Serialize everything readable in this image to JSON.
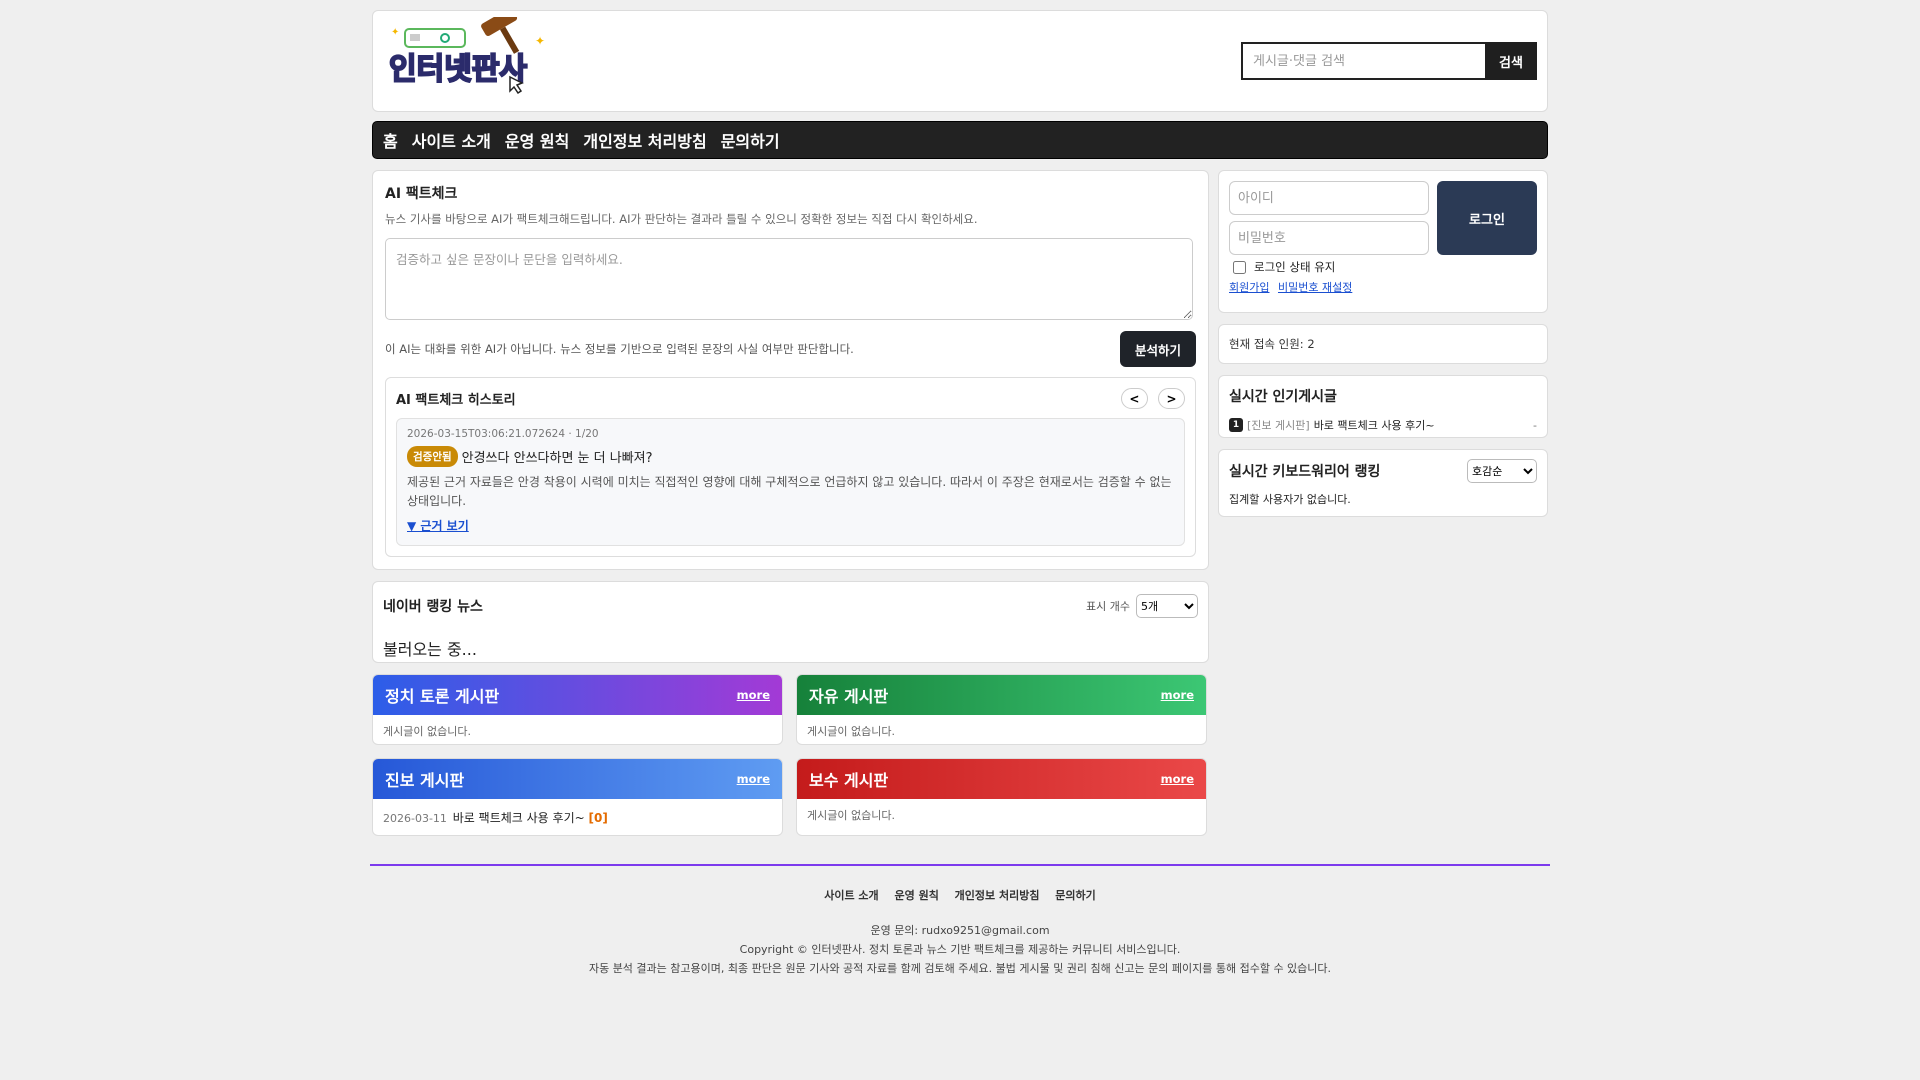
{
  "header": {
    "logo_text": "인터넷판사",
    "search_placeholder": "게시글·댓글 검색",
    "search_button": "검색"
  },
  "nav": [
    "홈",
    "사이트 소개",
    "운영 원칙",
    "개인정보 처리방침",
    "문의하기"
  ],
  "factcheck": {
    "title": "AI 팩트체크",
    "description": "뉴스 기사를 바탕으로 AI가 팩트체크해드립니다. AI가 판단하는 결과라 틀릴 수 있으니 정확한 정보는 직접 다시 확인하세요.",
    "textarea_placeholder": "검증하고 싶은 문장이나 문단을 입력하세요.",
    "note": "이 AI는 대화를 위한 AI가 아닙니다. 뉴스 정보를 기반으로 입력된 문장의 사실 여부만 판단합니다.",
    "analyze_button": "분석하기",
    "history": {
      "title": "AI 팩트체크 히스토리",
      "prev": "<",
      "next": ">",
      "entry": {
        "meta": "2026-03-15T03:06:21.072624 · 1/20",
        "badge": "검증안됨",
        "claim": "안경쓰다 안쓰다하면 눈 더 나빠져?",
        "reason": "제공된 근거 자료들은 안경 착용이 시력에 미치는 직접적인 영향에 대해 구체적으로 언급하지 않고 있습니다. 따라서 이 주장은 현재로서는 검증할 수 없는 상태입니다.",
        "toggle": "▼ 근거 보기"
      }
    }
  },
  "news": {
    "title": "네이버 랭킹 뉴스",
    "count_label": "표시 개수",
    "count_value": "5개",
    "loading": "불러오는 중..."
  },
  "boards": [
    {
      "title": "정치 토론 게시판",
      "more": "more",
      "empty": "게시글이 없습니다."
    },
    {
      "title": "자유 게시판",
      "more": "more",
      "empty": "게시글이 없습니다."
    },
    {
      "title": "진보 게시판",
      "more": "more",
      "post_date": "2026-03-11",
      "post_title": "바로 팩트체크 사용 후기~",
      "post_count": "[0]"
    },
    {
      "title": "보수 게시판",
      "more": "more",
      "empty": "게시글이 없습니다."
    }
  ],
  "login": {
    "id_placeholder": "아이디",
    "pw_placeholder": "비밀번호",
    "button": "로그인",
    "keep": "로그인 상태 유지",
    "signup": "회원가입",
    "reset": "비밀번호 재설정"
  },
  "online": "현재 접속 인원: 2",
  "popular": {
    "title": "실시간 인기게시글",
    "items": [
      {
        "rank": "1",
        "tag": "[진보 게시판]",
        "title": "바로 팩트체크 사용 후기~",
        "extra": "-"
      }
    ]
  },
  "keyboard": {
    "title": "실시간 키보드워리어 랭킹",
    "sort": "호감순",
    "empty": "집계할 사용자가 없습니다."
  },
  "footer": {
    "links": [
      "사이트 소개",
      "운영 원칙",
      "개인정보 처리방침",
      "문의하기"
    ],
    "contact": "운영 문의: rudxo9251@gmail.com",
    "copyright": "Copyright © 인터넷판사. 정치 토론과 뉴스 기반 팩트체크를 제공하는 커뮤니티 서비스입니다.",
    "disclaimer": "자동 분석 결과는 참고용이며, 최종 판단은 원문 기사와 공적 자료를 함께 검토해 주세요. 불법 게시물 및 권리 침해 신고는 문의 페이지를 통해 접수할 수 있습니다."
  },
  "colors": {
    "board_politics": [
      "#2c5ee8",
      "#a33ad6"
    ],
    "board_free": [
      "#16813a",
      "#3cc774"
    ],
    "board_progressive": [
      "#2658d8",
      "#5f9cf2"
    ],
    "board_conservative": [
      "#c41b1b",
      "#ea4848"
    ],
    "footer_line": "#7c3aed"
  }
}
